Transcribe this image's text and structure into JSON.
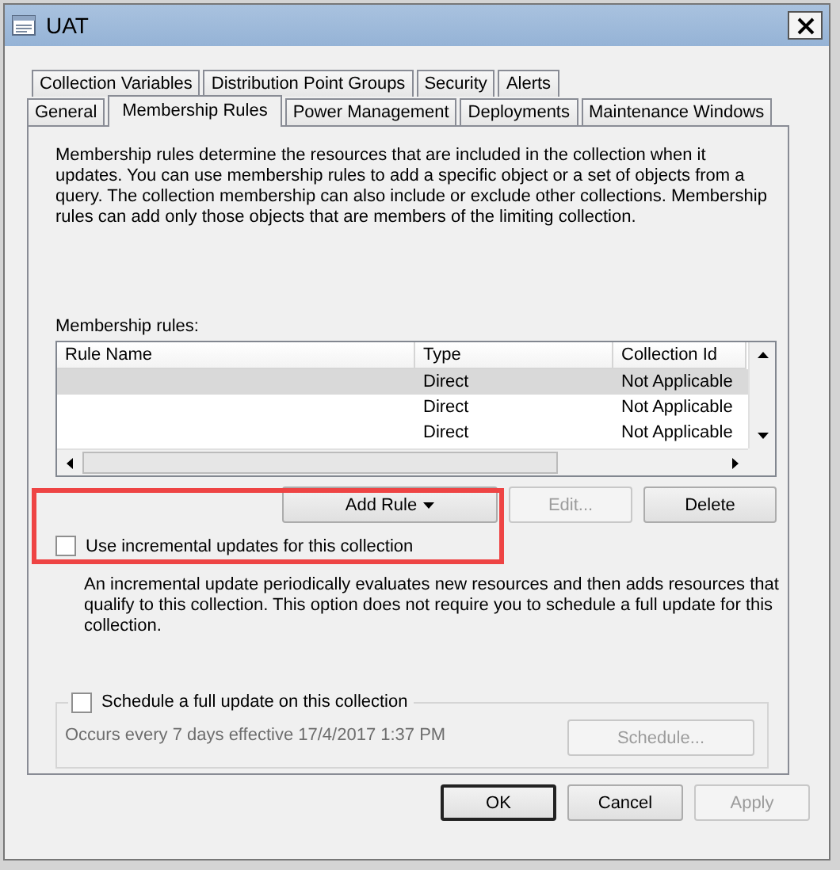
{
  "window": {
    "title": "UAT"
  },
  "tab_rows": [
    [
      {
        "label": "Collection Variables",
        "selected": false
      },
      {
        "label": "Distribution Point Groups",
        "selected": false
      },
      {
        "label": "Security",
        "selected": false
      },
      {
        "label": "Alerts",
        "selected": false
      }
    ],
    [
      {
        "label": "General",
        "selected": false
      },
      {
        "label": "Membership Rules",
        "selected": true
      },
      {
        "label": "Power Management",
        "selected": false
      },
      {
        "label": "Deployments",
        "selected": false
      },
      {
        "label": "Maintenance Windows",
        "selected": false
      }
    ]
  ],
  "description": "Membership rules determine the resources that are included in the collection when it updates. You can use membership rules to add a specific object or a set of objects from a query. The collection membership can also include or exclude other collections. Membership rules can add only those objects that are members of the limiting collection.",
  "rules_label": "Membership rules:",
  "table": {
    "columns": [
      "Rule Name",
      "Type",
      "Collection Id"
    ],
    "rows": [
      {
        "type": "Direct",
        "collection_id": "Not Applicable",
        "selected": true
      },
      {
        "type": "Direct",
        "collection_id": "Not Applicable",
        "selected": false
      },
      {
        "type": "Direct",
        "collection_id": "Not Applicable",
        "selected": false
      }
    ]
  },
  "rule_buttons": [
    {
      "label": "Add Rule",
      "dropdown": true,
      "disabled": false
    },
    {
      "label": "Edit...",
      "dropdown": false,
      "disabled": true
    },
    {
      "label": "Delete",
      "dropdown": false,
      "disabled": false
    }
  ],
  "incremental": {
    "label": "Use incremental updates for this collection",
    "checked": false,
    "description": "An incremental update periodically evaluates new resources and then adds resources that qualify to this collection. This option does not require you to schedule a full update for this collection."
  },
  "full_update": {
    "label": "Schedule a full update on this collection",
    "checked": false,
    "summary": "Occurs every 7 days effective 17/4/2017 1:37 PM",
    "button": {
      "label": "Schedule...",
      "disabled": true
    }
  },
  "dialog_buttons": [
    {
      "label": "OK",
      "default": true,
      "disabled": false
    },
    {
      "label": "Cancel",
      "default": false,
      "disabled": false
    },
    {
      "label": "Apply",
      "default": false,
      "disabled": true
    }
  ]
}
